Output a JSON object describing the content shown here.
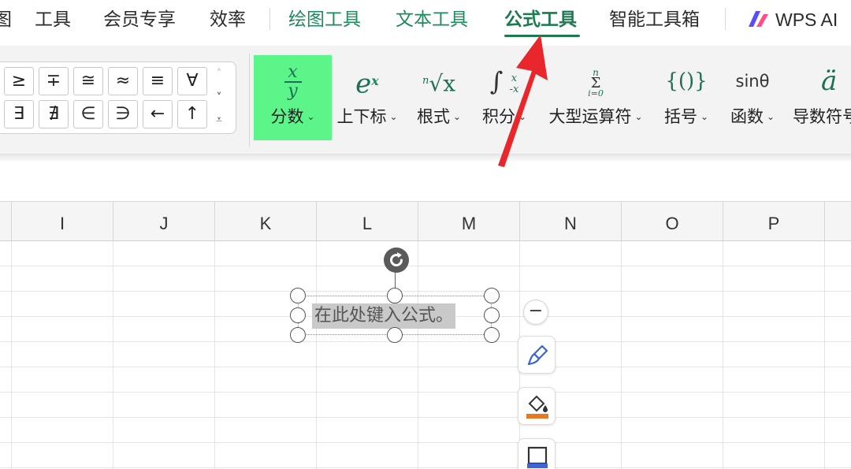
{
  "menu": {
    "tabs": [
      {
        "label": "图"
      },
      {
        "label": "工具"
      },
      {
        "label": "会员专享"
      },
      {
        "label": "效率"
      },
      {
        "label": "绘图工具"
      },
      {
        "label": "文本工具"
      },
      {
        "label": "公式工具"
      },
      {
        "label": "智能工具箱"
      },
      {
        "label": "WPS AI"
      }
    ],
    "active_tab": "公式工具"
  },
  "symbols": {
    "row1": [
      "≥",
      "∓",
      "≅",
      "≈",
      "≡",
      "∀"
    ],
    "row2": [
      "∃",
      "∄",
      "∈",
      "∋",
      "←",
      "↑"
    ],
    "scroll_up": "˄",
    "scroll_down": "˅",
    "expand": "⩡"
  },
  "ribbon": {
    "fraction": {
      "glyph_num": "x",
      "glyph_den": "y",
      "label": "分数"
    },
    "script": {
      "glyph": "e",
      "glyph_sup": "x",
      "label": "上下标"
    },
    "radical": {
      "glyph_index": "n",
      "glyph": "√x",
      "label": "根式"
    },
    "integral": {
      "glyph": "∫",
      "glyph_upper": "x",
      "glyph_lower": "-x",
      "label": "积分"
    },
    "large_operator": {
      "glyph_upper": "n",
      "glyph": "Σ",
      "glyph_lower": "i=0",
      "label": "大型运算符"
    },
    "bracket": {
      "glyph": "{()}",
      "label": "括号"
    },
    "function": {
      "glyph": "sinθ",
      "label": "函数"
    },
    "accent": {
      "glyph": "ä",
      "label": "导数符号"
    },
    "caret": "⌄"
  },
  "columns": [
    "I",
    "J",
    "K",
    "L",
    "M",
    "N",
    "O",
    "P"
  ],
  "equation": {
    "placeholder": "在此处键入公式。"
  },
  "floating_tools": {
    "collapse": "−"
  },
  "colors": {
    "accent_green": "#1b7a4e",
    "selected_button": "#5cf58a",
    "arrow_red": "#e8262b"
  }
}
